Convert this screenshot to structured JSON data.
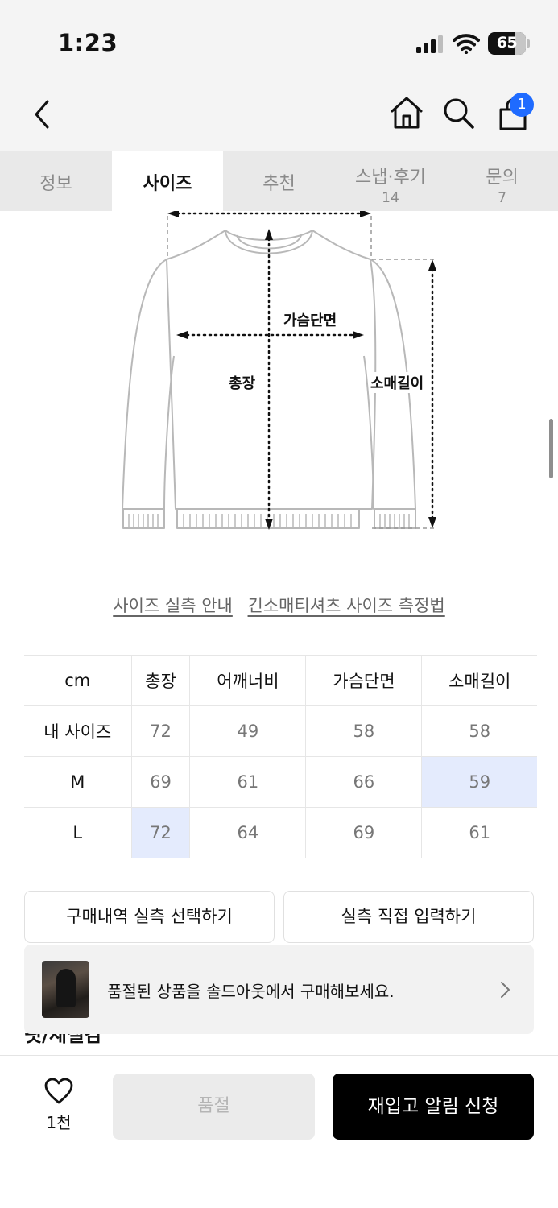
{
  "status_bar": {
    "time": "1:23",
    "battery": "65"
  },
  "nav": {
    "cart_badge": "1"
  },
  "tabs": [
    {
      "label": "정보",
      "count": ""
    },
    {
      "label": "사이즈",
      "count": ""
    },
    {
      "label": "추천",
      "count": ""
    },
    {
      "label": "스냅·후기",
      "count": "14"
    },
    {
      "label": "문의",
      "count": "7"
    }
  ],
  "active_tab": "사이즈",
  "diagram": {
    "chest_label": "가슴단면",
    "length_label": "총장",
    "sleeve_label": "소매길이"
  },
  "guide_links": [
    "사이즈 실측 안내",
    "긴소매티셔츠 사이즈 측정법"
  ],
  "size_table": {
    "unit": "cm",
    "columns": [
      "총장",
      "어깨너비",
      "가슴단면",
      "소매길이"
    ],
    "rows": [
      {
        "label": "내 사이즈",
        "values": [
          "72",
          "49",
          "58",
          "58"
        ]
      },
      {
        "label": "M",
        "values": [
          "69",
          "61",
          "66",
          "59"
        ]
      },
      {
        "label": "L",
        "values": [
          "72",
          "64",
          "69",
          "61"
        ]
      }
    ],
    "highlight_color": "#e4ebfd"
  },
  "buttons": {
    "purchase_history": "구매내역 실측 선택하기",
    "manual_input": "실측 직접 입력하기"
  },
  "banner": {
    "text": "품절된 상품을 솔드아웃에서 구매해보세요."
  },
  "cut_heading": "핏/재질감",
  "bottom_bar": {
    "like_count": "1천",
    "soldout_label": "품절",
    "restock_label": "재입고 알림 신청"
  },
  "colors": {
    "accent_blue": "#1f6bff",
    "primary_black": "#000000"
  }
}
